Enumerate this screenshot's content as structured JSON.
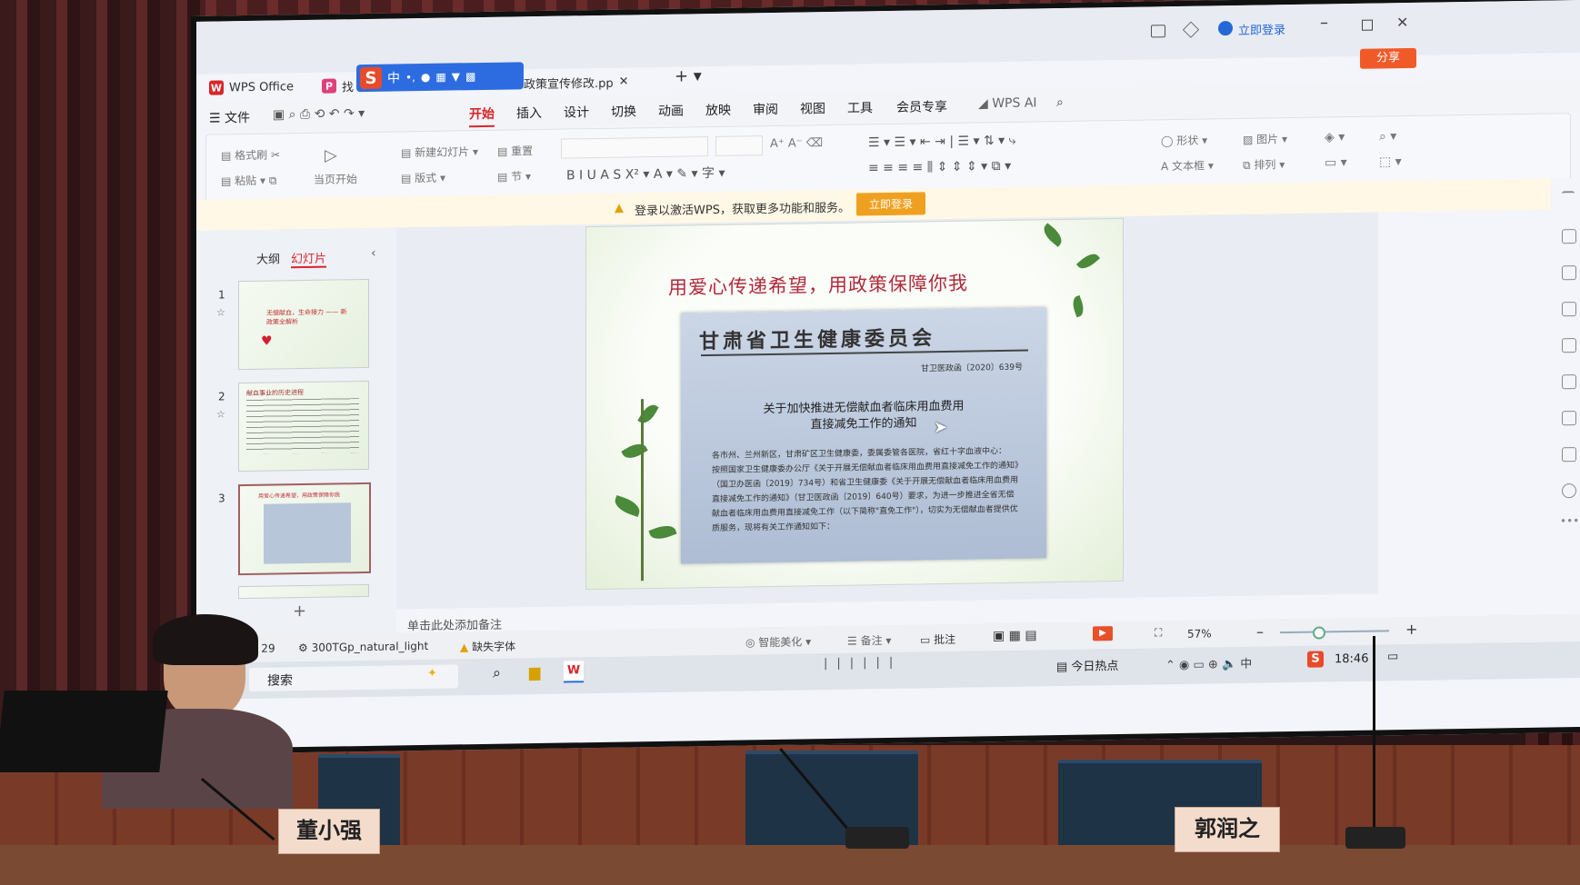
{
  "window": {
    "app_tab": "WPS Office",
    "doc_tab_short": "找",
    "doc_tab": "政策宣传修改.pp",
    "login_link": "立即登录",
    "share": "分享"
  },
  "ime": {
    "logo": "S",
    "lang": "中"
  },
  "menu": {
    "file": "文件",
    "items": [
      "开始",
      "插入",
      "设计",
      "切换",
      "动画",
      "放映",
      "审阅",
      "视图",
      "工具",
      "会员专享"
    ],
    "active": "开始",
    "ai": "WPS AI"
  },
  "ribbon": {
    "format_painter": "格式刷",
    "paste": "粘贴",
    "play_from_current": "当页开始",
    "new_slide": "新建幻灯片",
    "layout": "版式",
    "reset": "重置",
    "section": "节",
    "shape": "形状",
    "picture": "图片",
    "textbox": "文本框",
    "arrange": "排列"
  },
  "notice": {
    "text": "登录以激活WPS，获取更多功能和服务。",
    "button": "立即登录"
  },
  "left_pane": {
    "tab_outline": "大纲",
    "tab_slides": "幻灯片",
    "thumbs": [
      {
        "num": "1",
        "title": "无偿献血，生命接力 —— 新政策全解析"
      },
      {
        "num": "2",
        "title": "献血事业的历史进程"
      },
      {
        "num": "3",
        "title": "用爱心传递希望，用政策保障你我"
      }
    ]
  },
  "slide": {
    "title": "用爱心传递希望，用政策保障你我",
    "doc_header": "甘肃省卫生健康委员会",
    "doc_number": "甘卫医政函〔2020〕639号",
    "doc_title_1": "关于加快推进无偿献血者临床用血费用",
    "doc_title_2": "直接减免工作的通知",
    "doc_body": "各市州、兰州新区，甘肃矿区卫生健康委，委属委管各医院，省红十字血液中心：　　按照国家卫生健康委办公厅《关于开展无偿献血者临床用血费用直接减免工作的通知》（国卫办医函〔2019〕734号）和省卫生健康委《关于开展无偿献血者临床用血费用直接减免工作的通知》（甘卫医政函〔2019〕640号）要求，为进一步推进全省无偿献血者临床用血费用直接减免工作（以下简称\"直免工作\"），切实为无偿献血者提供优质服务，现将有关工作通知如下："
  },
  "notes_placeholder": "单击此处添加备注",
  "status": {
    "page": "3 / 29",
    "theme": "300TGp_natural_light",
    "missing_font": "缺失字体",
    "beautify": "智能美化",
    "notes": "备注",
    "comments": "批注",
    "zoom": "57%"
  },
  "taskbar": {
    "search": "搜索",
    "news": "今日热点",
    "time": "18:46"
  },
  "nameplates": [
    "董小强",
    "郭润之"
  ]
}
